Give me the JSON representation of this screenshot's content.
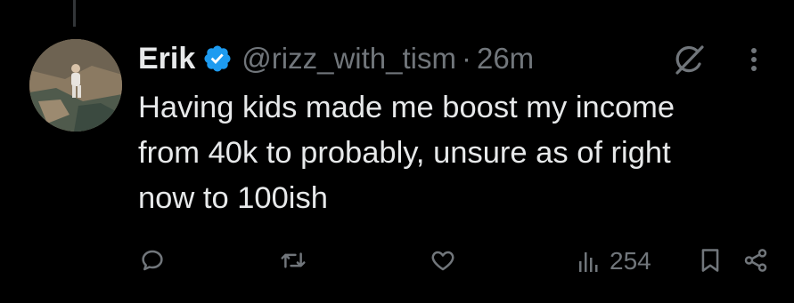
{
  "tweet": {
    "display_name": "Erik",
    "verified": true,
    "handle": "@rizz_with_tism",
    "separator": "·",
    "time": "26m",
    "text_lines": [
      "Having kids made me boost my income",
      "from 40k to probably, unsure as of right",
      "now to 100ish"
    ]
  },
  "actions": {
    "reply_icon": "reply-icon",
    "retweet_icon": "retweet-icon",
    "like_icon": "heart-icon",
    "views_icon": "views-icon",
    "views_count": "254",
    "bookmark_icon": "bookmark-icon",
    "share_icon": "share-icon"
  },
  "colors": {
    "background": "#000000",
    "primary_text": "#e7e9ea",
    "secondary_text": "#71767b",
    "verified_badge": "#1d9bf0"
  }
}
